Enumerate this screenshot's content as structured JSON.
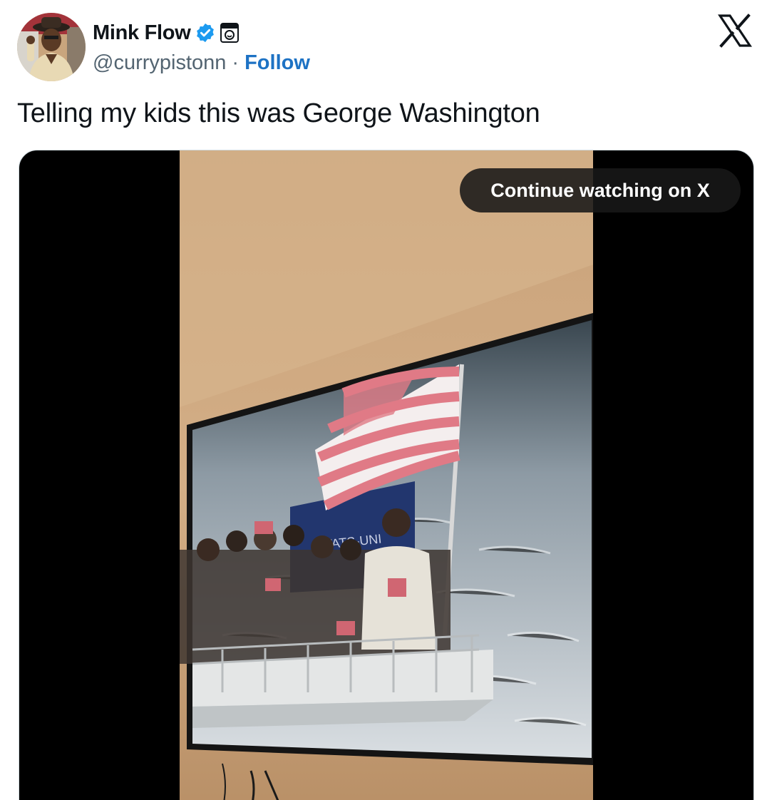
{
  "author": {
    "display_name": "Mink Flow",
    "handle": "@currypistonn",
    "separator": "·",
    "follow_label": "Follow",
    "verified_icon": "verified-badge-icon",
    "affiliate_icon": "affiliate-badge-icon"
  },
  "brand": {
    "logo_icon": "x-logo-icon"
  },
  "tweet": {
    "text": "Telling my kids this was George Washington"
  },
  "media": {
    "overlay_label": "Continue watching on X",
    "flag_banner_text": "ETATS-UNI"
  },
  "colors": {
    "link": "#1d72c4",
    "verified": "#1d9bf0",
    "secondary_text": "#536471",
    "media_bg": "#000000"
  }
}
